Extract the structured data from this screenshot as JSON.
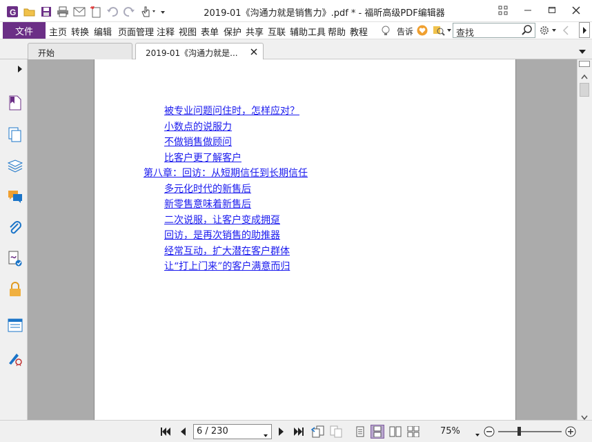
{
  "window": {
    "title": "2019-01《沟通力就是销售力》.pdf * - 福昕高级PDF编辑器"
  },
  "menubar": {
    "file_label": "文件",
    "items": [
      "主页",
      "转换",
      "编辑",
      "页面管理",
      "注释",
      "视图",
      "表单",
      "保护",
      "共享",
      "互联",
      "辅助工具",
      "帮助",
      "教程"
    ],
    "tell_label": "告诉",
    "search_placeholder": "查找"
  },
  "tabs": [
    {
      "label": "开始"
    },
    {
      "label": "2019-01《沟通力就是..."
    }
  ],
  "document": {
    "toc": [
      {
        "text": "被专业问题问住时，怎样应对？",
        "level": 2
      },
      {
        "text": "小数点的说服力",
        "level": 2
      },
      {
        "text": "不做销售做顾问",
        "level": 2
      },
      {
        "text": "比客户更了解客户",
        "level": 2
      },
      {
        "text": "第八章：回访：从短期信任到长期信任",
        "level": 1
      },
      {
        "text": "多元化时代的新售后",
        "level": 2
      },
      {
        "text": "新零售意味着新售后",
        "level": 2
      },
      {
        "text": "二次说服，让客户变成拥趸",
        "level": 2
      },
      {
        "text": "回访，是再次销售的助推器",
        "level": 2
      },
      {
        "text": "经常互动，扩大潜在客户群体",
        "level": 2
      },
      {
        "text": "让“打上门来”的客户满意而归",
        "level": 2
      }
    ]
  },
  "statusbar": {
    "page_value": "6 / 230",
    "zoom_value": "75%",
    "zoom_level": 0.33
  },
  "colors": {
    "brand": "#6b2f86",
    "link": "#1a1aee",
    "doc_background": "#ababab"
  },
  "icons": {
    "app": "foxit-logo-icon",
    "sidebar": [
      "bookmark-icon",
      "pages-icon",
      "layers-icon",
      "comments-icon",
      "attachments-icon",
      "signature-icon",
      "security-icon",
      "form-icon",
      "sign-pen-icon"
    ]
  }
}
